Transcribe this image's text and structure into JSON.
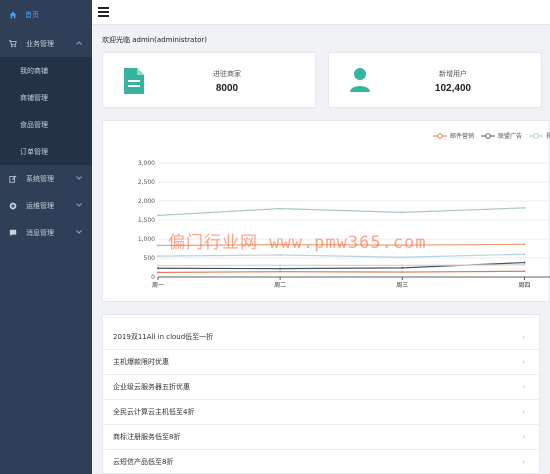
{
  "sidebar": {
    "top_item": "首页",
    "groups": [
      {
        "label": "业务管理"
      },
      {
        "label": "系统管理"
      },
      {
        "label": "运维管理"
      },
      {
        "label": "消息管理"
      }
    ],
    "sub_items": [
      "我的商铺",
      "商铺管理",
      "食品管理",
      "订单管理"
    ]
  },
  "header": {
    "welcome": "欢迎光临 admin(administrator)"
  },
  "stats": [
    {
      "label": "进驻商家",
      "value": "8000",
      "icon": "document-icon",
      "color": "#35b59d"
    },
    {
      "label": "新增用户",
      "value": "102,400",
      "icon": "user-icon",
      "color": "#35b59d"
    }
  ],
  "chart_data": {
    "type": "line",
    "categories": [
      "周一",
      "周二",
      "周三",
      "周四"
    ],
    "ylim": [
      0,
      3000
    ],
    "yticks": [
      "0",
      "500",
      "1,000",
      "1,500",
      "2,000",
      "2,500",
      "3,000"
    ],
    "legend": [
      "邮件营销",
      "联盟广告",
      "视频"
    ],
    "series": [
      {
        "name": "邮件营销",
        "color": "#e8774f",
        "values": [
          120,
          140,
          130,
          150
        ]
      },
      {
        "name": "联盟广告",
        "color": "#445566",
        "values": [
          230,
          220,
          240,
          380
        ]
      },
      {
        "name": "视频",
        "color": "#a7c8c4",
        "values": [
          1620,
          1800,
          1700,
          1820
        ]
      },
      {
        "color": "#e6a07a",
        "values": [
          830,
          850,
          840,
          860
        ]
      },
      {
        "color": "#b7d0e8",
        "values": [
          550,
          580,
          520,
          600
        ]
      },
      {
        "color": "#d9d4c8",
        "values": [
          300,
          310,
          305,
          320
        ]
      }
    ]
  },
  "watermark": "偏门行业网 www.pmw365.com",
  "promos": [
    "2019双11All in cloud低至一折",
    "主机爆款限时优惠",
    "企业级云服务器五折优惠",
    "全民云计算云主机低至4折",
    "商标注册服务低至8折",
    "云短信产品低至8折"
  ]
}
